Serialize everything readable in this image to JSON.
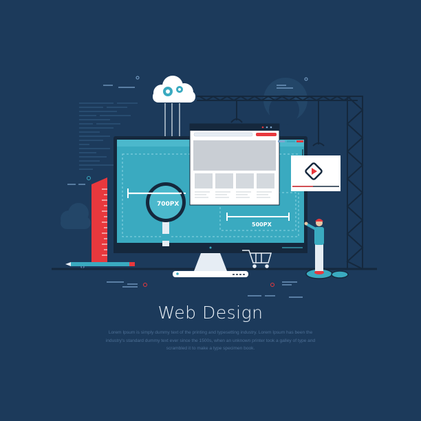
{
  "heading": "Web Design",
  "description": "Lorem Ipsum is simply dummy text of the printing and typesetting industry. Lorem Ipsum has been the industry's standard dummy text ever since the 1500s, when an unknown printer took a galley of type and scrambled it to make a type specimen book.",
  "monitor": {
    "width_label": "700PX",
    "height_label": "500PX"
  },
  "colors": {
    "background": "#1c3a5b",
    "screen": "#3aaac0",
    "accent_red": "#e8383d",
    "light": "#ffffff",
    "dark": "#15283d"
  },
  "icons": [
    "cloud-gears-icon",
    "magnifier-icon",
    "ruler-icon",
    "pencil-icon",
    "shopping-cart-icon",
    "video-play-icon",
    "crane-icon",
    "gear-icon",
    "person-icon"
  ]
}
